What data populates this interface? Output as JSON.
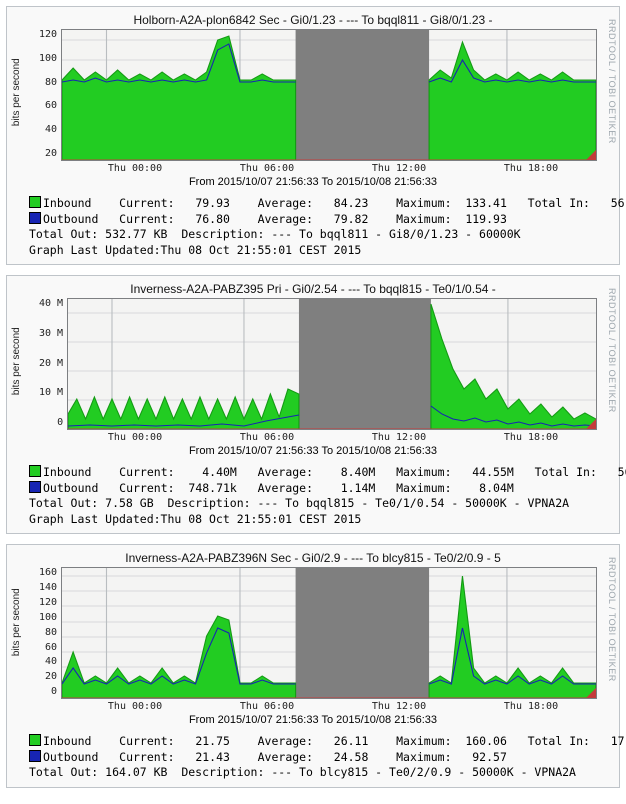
{
  "brand": "RRDTOOL / TOBI OETIKER",
  "graphs": [
    {
      "title": "Holborn-A2A-plon6842 Sec - Gi0/1.23 - --- To bqql811 - Gi8/0/1.23 -",
      "ylabel": "bits per second",
      "yticks": [
        "120",
        "100",
        "80",
        "60",
        "40",
        "20"
      ],
      "xticks": [
        "Thu 00:00",
        "Thu 06:00",
        "Thu 12:00",
        "Thu 18:00"
      ],
      "daterange": "From 2015/10/07 21:56:33 To 2015/10/08 21:56:33",
      "legend_inbound": "Inbound    Current:   79.93    Average:   84.23    Maximum:  133.41   Total In:   56",
      "legend_outbound": "Outbound   Current:   76.80    Average:   79.82    Maximum:  119.93",
      "line3": "Total Out: 532.77 KB  Description: --- To bqql811 - Gi8/0/1.23 - 60000K",
      "line4": "Graph Last Updated:Thu 08 Oct 21:55:01 CEST 2015"
    },
    {
      "title": "Inverness-A2A-PABZ395 Pri - Gi0/2.54 - --- To bqql815 - Te0/1/0.54 -",
      "ylabel": "bits per second",
      "yticks": [
        "40 M",
        "30 M",
        "20 M",
        "10 M",
        "0"
      ],
      "xticks": [
        "Thu 00:00",
        "Thu 06:00",
        "Thu 12:00",
        "Thu 18:00"
      ],
      "daterange": "From 2015/10/07 21:56:33 To 2015/10/08 21:56:33",
      "legend_inbound": "Inbound    Current:    4.40M   Average:    8.40M   Maximum:   44.55M   Total In:   56",
      "legend_outbound": "Outbound   Current:  748.71k   Average:    1.14M   Maximum:    8.04M",
      "line3": "Total Out: 7.58 GB  Description: --- To bqql815 - Te0/1/0.54 - 50000K - VPNA2A",
      "line4": "Graph Last Updated:Thu 08 Oct 21:55:01 CEST 2015"
    },
    {
      "title": "Inverness-A2A-PABZ396N Sec - Gi0/2.9 - --- To blcy815 - Te0/2/0.9 - 5",
      "ylabel": "bits per second",
      "yticks": [
        "160",
        "140",
        "120",
        "100",
        "80",
        "60",
        "40",
        "20",
        "0"
      ],
      "xticks": [
        "Thu 00:00",
        "Thu 06:00",
        "Thu 12:00",
        "Thu 18:00"
      ],
      "daterange": "From 2015/10/07 21:56:33 To 2015/10/08 21:56:33",
      "legend_inbound": "Inbound    Current:   21.75    Average:   26.11    Maximum:  160.06   Total In:   17",
      "legend_outbound": "Outbound   Current:   21.43    Average:   24.58    Maximum:   92.57",
      "line3": "Total Out: 164.07 KB  Description: --- To blcy815 - Te0/2/0.9 - 50000K - VPNA2A",
      "line4": ""
    }
  ],
  "chart_data": [
    {
      "type": "area",
      "title": "Holborn-A2A-plon6842 Sec - Gi0/1.23",
      "xlabel": "",
      "ylabel": "bits per second",
      "ylim": [
        0,
        130
      ],
      "x_hours": [
        -2,
        -1,
        0,
        1,
        2,
        3,
        4,
        5,
        6,
        7,
        8,
        8.5,
        14.5,
        15,
        16,
        17,
        18,
        19,
        20,
        21,
        22
      ],
      "gap_hours": [
        8.5,
        14.5
      ],
      "series": [
        {
          "name": "Inbound",
          "color": "#22cc22",
          "values": [
            80,
            92,
            80,
            88,
            80,
            90,
            80,
            120,
            125,
            80,
            80,
            null,
            null,
            80,
            90,
            82,
            118,
            90,
            80,
            85,
            80
          ]
        },
        {
          "name": "Outbound",
          "color": "#1724b3",
          "values": [
            78,
            80,
            78,
            82,
            78,
            80,
            78,
            110,
            118,
            78,
            78,
            null,
            null,
            78,
            82,
            80,
            100,
            82,
            78,
            80,
            78
          ]
        }
      ]
    },
    {
      "type": "area",
      "title": "Inverness-A2A-PABZ395 Pri - Gi0/2.54",
      "xlabel": "",
      "ylabel": "bits per second",
      "ylim": [
        0,
        45000000
      ],
      "x_hours": [
        -2,
        -1,
        0,
        1,
        2,
        3,
        4,
        5,
        6,
        7,
        8,
        8.5,
        14.5,
        15,
        16,
        17,
        18,
        19,
        20,
        21,
        22
      ],
      "gap_hours": [
        8.5,
        14.5
      ],
      "series": [
        {
          "name": "Inbound",
          "color": "#22cc22",
          "values": [
            5,
            9,
            4,
            10,
            3,
            9,
            4,
            10,
            5,
            11,
            12,
            null,
            null,
            44,
            32,
            20,
            12,
            15,
            8,
            10,
            5
          ],
          "scale": "M"
        },
        {
          "name": "Outbound",
          "color": "#1724b3",
          "values": [
            0.8,
            1,
            0.7,
            1.2,
            0.7,
            1.1,
            0.7,
            1.3,
            0.8,
            2,
            3,
            null,
            null,
            8,
            5,
            3,
            2,
            3,
            1.5,
            2,
            0.8
          ],
          "scale": "M"
        }
      ]
    },
    {
      "type": "area",
      "title": "Inverness-A2A-PABZ396N Sec - Gi0/2.9",
      "xlabel": "",
      "ylabel": "bits per second",
      "ylim": [
        0,
        170
      ],
      "x_hours": [
        -2,
        -1,
        0,
        1,
        2,
        3,
        4,
        5,
        6,
        7,
        8,
        8.5,
        14.5,
        15,
        16,
        17,
        18,
        19,
        20,
        21,
        22
      ],
      "gap_hours": [
        8.5,
        14.5
      ],
      "series": [
        {
          "name": "Inbound",
          "color": "#22cc22",
          "values": [
            20,
            60,
            20,
            30,
            20,
            40,
            20,
            80,
            110,
            22,
            22,
            null,
            null,
            20,
            30,
            22,
            160,
            40,
            22,
            30,
            20
          ]
        },
        {
          "name": "Outbound",
          "color": "#1724b3",
          "values": [
            20,
            40,
            20,
            25,
            20,
            30,
            20,
            60,
            92,
            20,
            20,
            null,
            null,
            20,
            25,
            20,
            90,
            30,
            20,
            25,
            20
          ]
        }
      ]
    }
  ]
}
